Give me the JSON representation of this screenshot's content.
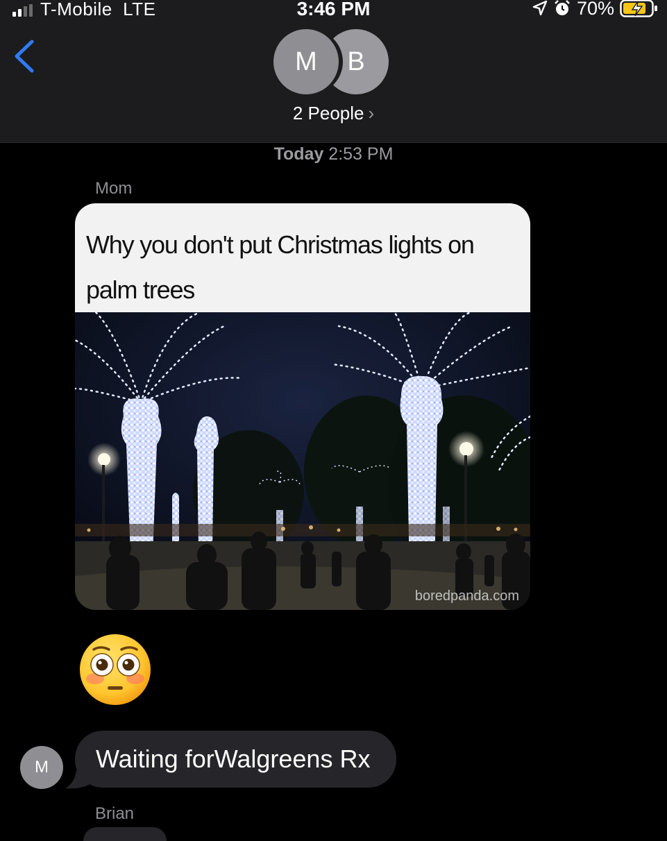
{
  "status_bar": {
    "carrier": "T-Mobile",
    "network": "LTE",
    "time": "3:46 PM",
    "battery_percent": "70%",
    "signal_bars": 2,
    "icons": [
      "signal-icon",
      "location-icon",
      "alarm-icon",
      "battery-charging-icon"
    ]
  },
  "header": {
    "avatars": [
      "M",
      "B"
    ],
    "people_label": "2 People",
    "back_icon": "chevron-left-icon"
  },
  "thread": {
    "timestamp_day": "Today",
    "timestamp_time": "2:53 PM",
    "messages": [
      {
        "sender": "Mom",
        "type": "image",
        "caption": "Why you don't put Christmas lights on palm trees",
        "watermark": "boredpanda.com"
      },
      {
        "type": "emoji",
        "emoji_name": "flushed-face-emoji"
      },
      {
        "type": "text",
        "avatar": "M",
        "text": "Waiting forWalgreens Rx"
      }
    ],
    "next_sender": "Brian"
  },
  "colors": {
    "background": "#000000",
    "header_bg": "#1c1c1e",
    "incoming_bubble": "#26252a",
    "accent_blue": "#2f7cf6",
    "secondary_text": "#8e8e93"
  }
}
